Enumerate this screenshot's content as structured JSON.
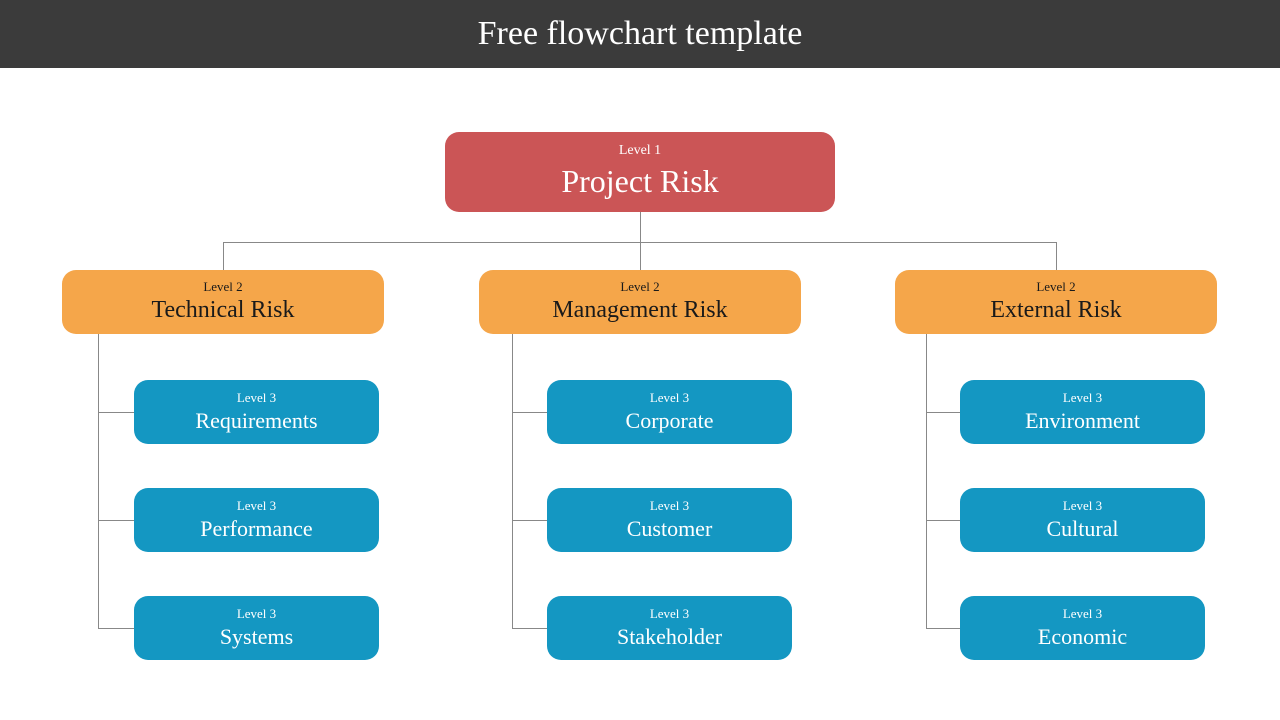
{
  "header": {
    "title": "Free flowchart template"
  },
  "root": {
    "level": "Level 1",
    "title": "Project Risk"
  },
  "branches": [
    {
      "level": "Level 2",
      "title": "Technical Risk",
      "children": [
        {
          "level": "Level 3",
          "title": "Requirements"
        },
        {
          "level": "Level 3",
          "title": "Performance"
        },
        {
          "level": "Level 3",
          "title": "Systems"
        }
      ]
    },
    {
      "level": "Level 2",
      "title": "Management Risk",
      "children": [
        {
          "level": "Level 3",
          "title": "Corporate"
        },
        {
          "level": "Level 3",
          "title": "Customer"
        },
        {
          "level": "Level 3",
          "title": "Stakeholder"
        }
      ]
    },
    {
      "level": "Level 2",
      "title": "External Risk",
      "children": [
        {
          "level": "Level 3",
          "title": "Environment"
        },
        {
          "level": "Level 3",
          "title": "Cultural"
        },
        {
          "level": "Level 3",
          "title": "Economic"
        }
      ]
    }
  ]
}
